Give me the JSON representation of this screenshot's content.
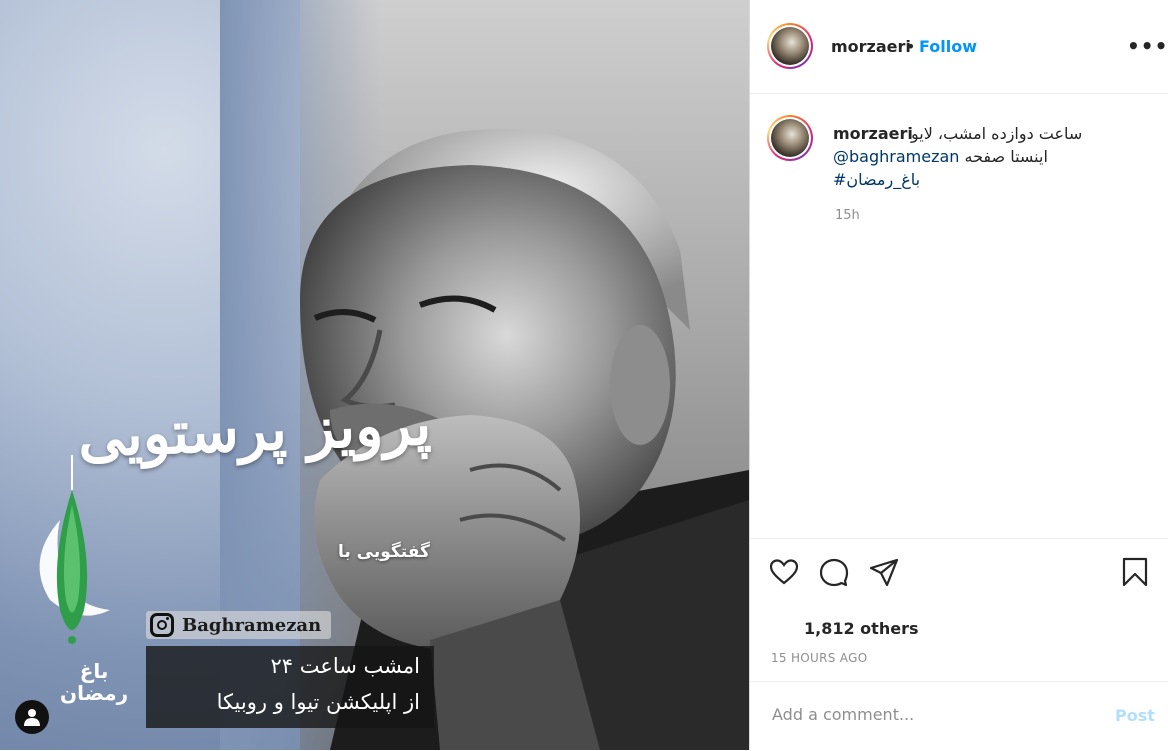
{
  "media": {
    "interview_label": "گفتگویی با",
    "guest_name": "پرویز پرستویی",
    "instagram_handle": "Baghramezan",
    "schedule_line1": "امشب ساعت ۲۴",
    "schedule_line2": "از اپلیکشن تیوا و روبیکا",
    "logo_text_line1": "باغ",
    "logo_text_line2": "رمضان"
  },
  "header": {
    "username": "morzaeri",
    "separator": "•",
    "follow_label": "Follow",
    "more_label": "•••"
  },
  "caption": {
    "username": "morzaeri",
    "line1": "ساعت دوازده امشب، لایو",
    "mention": "@baghramezan",
    "line2_suffix": "اینستا صفحه",
    "hashtag": "باغ_رمضان#",
    "time": "15h"
  },
  "likes": {
    "text": "1,812 others"
  },
  "posted_time": "15 HOURS AGO",
  "comment": {
    "placeholder": "Add a comment...",
    "post_label": "Post"
  },
  "icons": [
    "heart-icon",
    "comment-icon",
    "share-icon",
    "bookmark-icon",
    "user-tag-icon",
    "instagram-icon",
    "more-icon"
  ],
  "colors": {
    "follow": "#0095f6",
    "link": "#00376b",
    "post_disabled": "#b2dffc",
    "muted": "#8e8e8e"
  }
}
